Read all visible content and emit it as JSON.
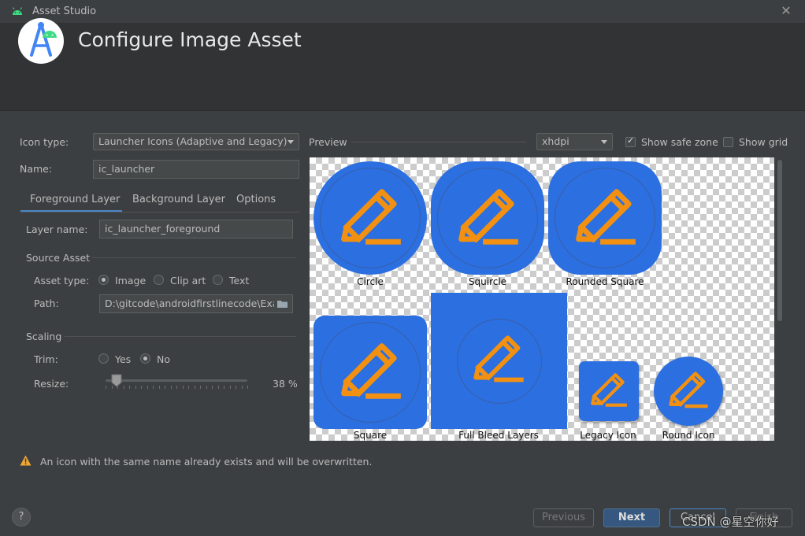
{
  "window": {
    "title": "Asset Studio",
    "close_symbol": "✕"
  },
  "header": {
    "title": "Configure Image Asset"
  },
  "form": {
    "icon_type_label": "Icon type:",
    "icon_type_value": "Launcher Icons (Adaptive and Legacy)",
    "name_label": "Name:",
    "name_value": "ic_launcher"
  },
  "tabs": [
    {
      "label": "Foreground Layer",
      "active": true
    },
    {
      "label": "Background Layer",
      "active": false
    },
    {
      "label": "Options",
      "active": false
    }
  ],
  "foreground": {
    "layer_name_label": "Layer name:",
    "layer_name_value": "ic_launcher_foreground",
    "source_asset_heading": "Source Asset",
    "asset_type_label": "Asset type:",
    "asset_type_options": [
      "Image",
      "Clip art",
      "Text"
    ],
    "asset_type_selected": "Image",
    "path_label": "Path:",
    "path_value": "D:\\gitcode\\androidfirstlinecode\\Exar",
    "scaling_heading": "Scaling",
    "trim_label": "Trim:",
    "trim_options": [
      "Yes",
      "No"
    ],
    "trim_selected": "No",
    "resize_label": "Resize:",
    "resize_value": "38 %",
    "resize_fraction": 0.38
  },
  "preview": {
    "label": "Preview",
    "density": "xhdpi",
    "show_safe_zone_label": "Show safe zone",
    "show_safe_zone": true,
    "show_grid_label": "Show grid",
    "show_grid": false,
    "icon_color": "#2b6fe0",
    "glyph_color": "#f29111",
    "captions": {
      "circle": "Circle",
      "squircle": "Squircle",
      "rounded_square": "Rounded Square",
      "square": "Square",
      "full_bleed": "Full Bleed Layers",
      "legacy": "Legacy Icon",
      "round": "Round Icon"
    }
  },
  "warning": {
    "text": "An icon with the same name already exists and will be overwritten."
  },
  "buttons": {
    "help": "?",
    "previous": "Previous",
    "next": "Next",
    "cancel": "Cancel",
    "finish": "Finish"
  },
  "watermark": "CSDN @星空你好"
}
